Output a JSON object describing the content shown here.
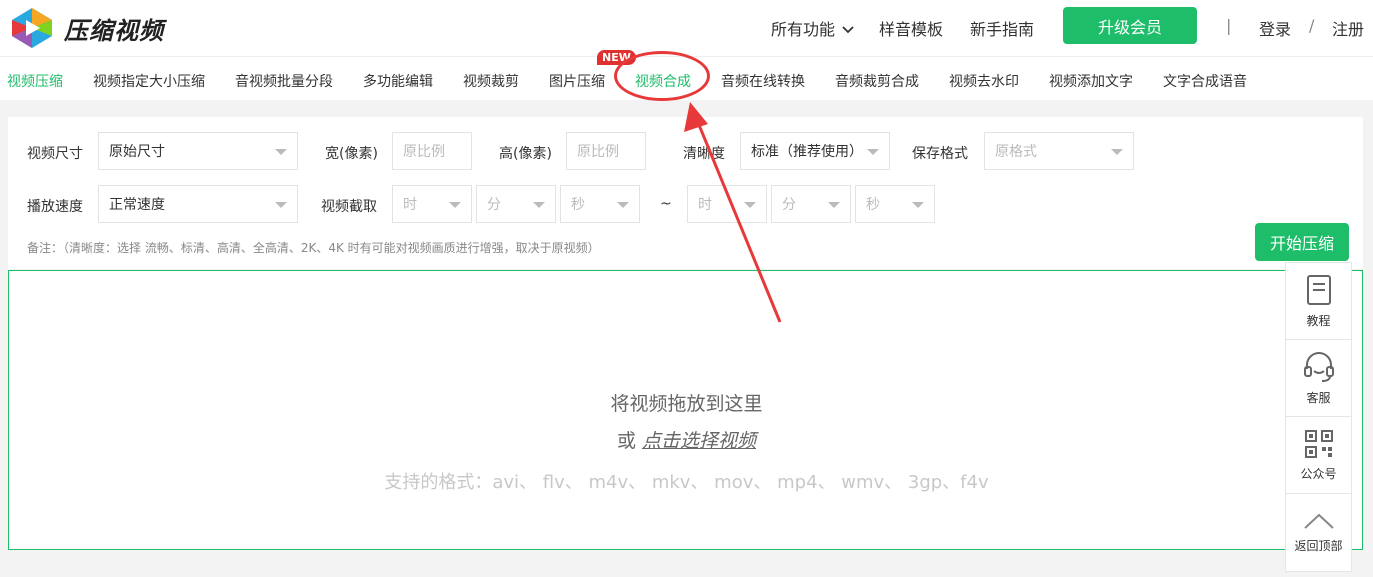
{
  "header": {
    "logo_text": "压缩视频",
    "links": [
      "所有功能",
      "样音模板",
      "新手指南"
    ],
    "upgrade_label": "升级会员",
    "login_label": "登录",
    "slash": "/",
    "register_label": "注册",
    "divider": "|"
  },
  "nav": {
    "items": [
      "视频压缩",
      "视频指定大小压缩",
      "音视频批量分段",
      "多功能编辑",
      "视频裁剪",
      "图片压缩",
      "视频合成",
      "音频在线转换",
      "音频裁剪合成",
      "视频去水印",
      "视频添加文字",
      "文字合成语音"
    ],
    "new_badge": "NEW"
  },
  "settings": {
    "size_label": "视频尺寸",
    "size_value": "原始尺寸",
    "width_label": "宽(像素)",
    "width_placeholder": "原比例",
    "height_label": "高(像素)",
    "height_placeholder": "原比例",
    "clarity_label": "清晰度",
    "clarity_value": "标准（推荐使用）",
    "format_label": "保存格式",
    "format_value": "原格式",
    "speed_label": "播放速度",
    "speed_value": "正常速度",
    "clip_label": "视频截取",
    "hour": "时",
    "minute": "分",
    "second": "秒",
    "tilde": "~",
    "note": "备注：（清晰度：选择 流畅、标清、高清、全高清、2K、4K 时有可能对视频画质进行增强，取决于原视频）",
    "start_label": "开始压缩"
  },
  "dropzone": {
    "title": "将视频拖放到这里",
    "or": "或",
    "pick": "点击选择视频",
    "formats": "支持的格式：avi、 flv、 m4v、 mkv、 mov、 mp4、 wmv、 3gp、f4v"
  },
  "side": {
    "tutorial": "教程",
    "service": "客服",
    "wechat": "公众号",
    "top": "返回顶部"
  },
  "colors": {
    "accent": "#1ebd6a",
    "highlight": "#e8393a"
  }
}
